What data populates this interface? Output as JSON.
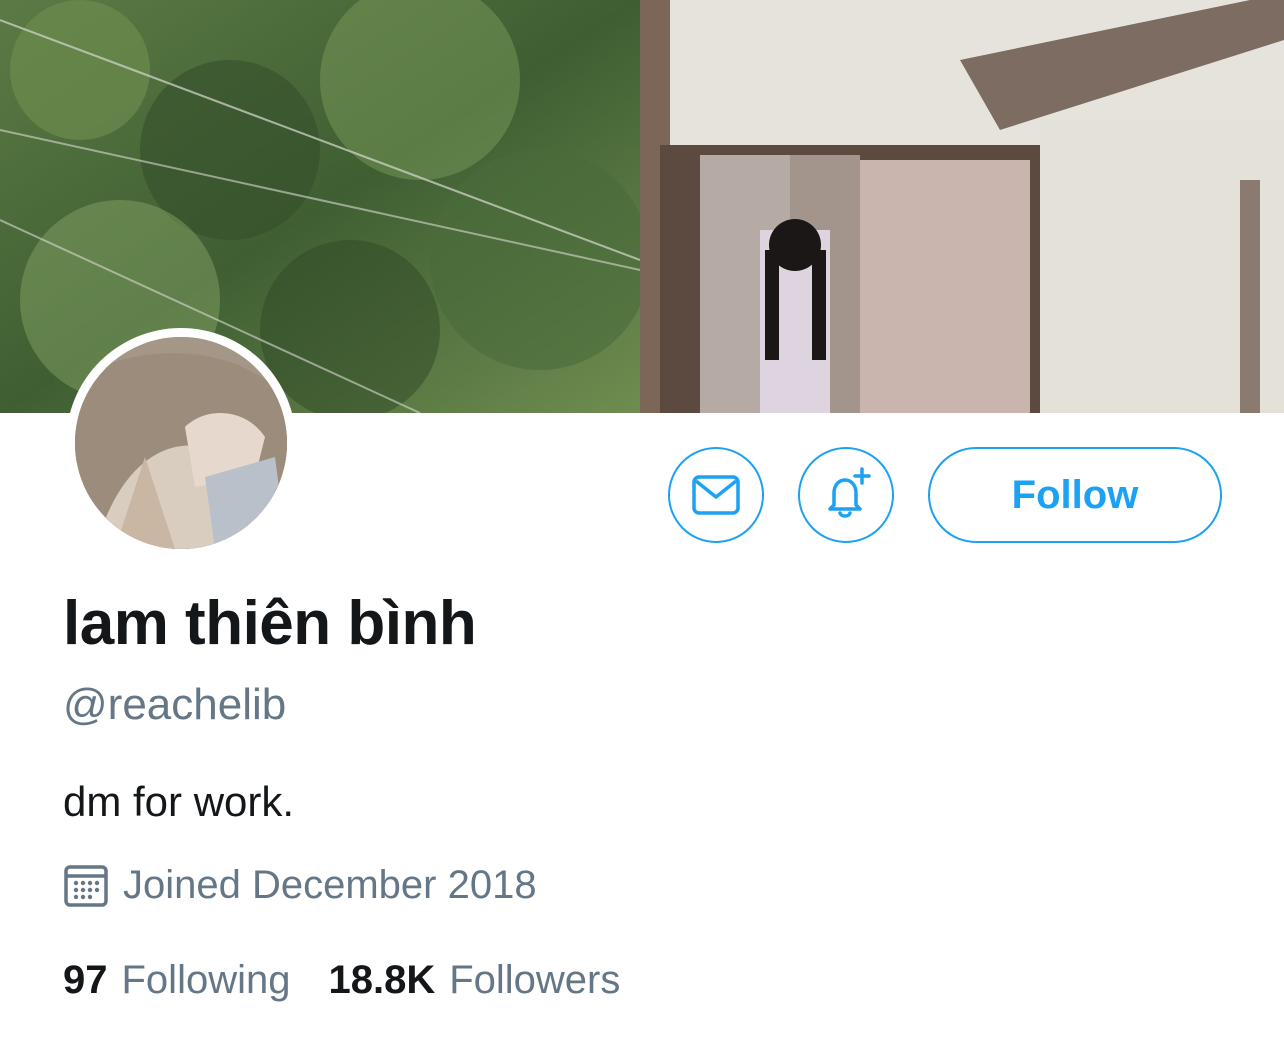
{
  "profile": {
    "name": "lam thiên bình",
    "handle": "@reachelib",
    "bio": "dm for work.",
    "joined": "Joined December 2018",
    "following_count": "97",
    "following_label": "Following",
    "followers_count": "18.8K",
    "followers_label": "Followers"
  },
  "actions": {
    "message_icon": "envelope-icon",
    "notify_icon": "bell-plus-icon",
    "follow_label": "Follow"
  },
  "colors": {
    "accent": "#1da1f2",
    "primary_text": "#14171a",
    "secondary_text": "#657786"
  }
}
